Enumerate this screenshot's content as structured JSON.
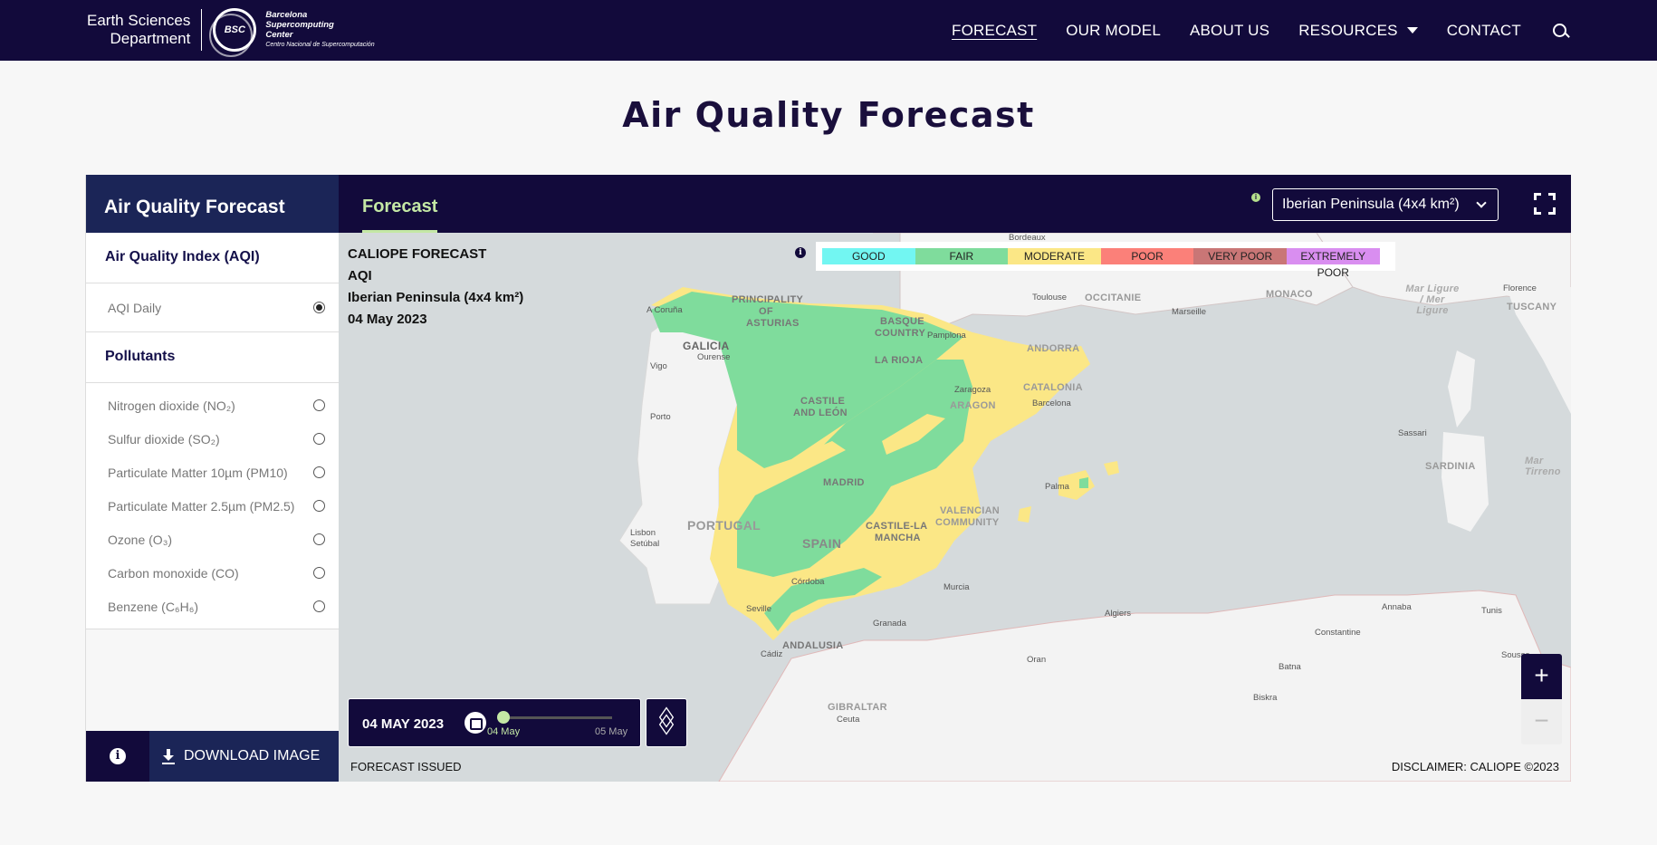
{
  "header": {
    "dept_line1": "Earth Sciences",
    "dept_line2": "Department",
    "bsc_badge": "BSC",
    "bsc_name1": "Barcelona",
    "bsc_name2": "Supercomputing",
    "bsc_name3": "Center",
    "bsc_sub": "Centro Nacional de Supercomputación",
    "nav": [
      "FORECAST",
      "OUR MODEL",
      "ABOUT US",
      "RESOURCES",
      "CONTACT"
    ]
  },
  "page_title": "Air Quality Forecast",
  "sidebar": {
    "title": "Air Quality Forecast",
    "section_aqi": "Air Quality Index (AQI)",
    "aqi_options": [
      {
        "label": "AQI Daily",
        "selected": true
      }
    ],
    "section_pollutants": "Pollutants",
    "pollutants": [
      {
        "label": "Nitrogen dioxide (NO₂)",
        "selected": false
      },
      {
        "label": "Sulfur dioxide (SO₂)",
        "selected": false
      },
      {
        "label": "Particulate Matter 10µm (PM10)",
        "selected": false
      },
      {
        "label": "Particulate Matter 2.5µm (PM2.5)",
        "selected": false
      },
      {
        "label": "Ozone (O₃)",
        "selected": false
      },
      {
        "label": "Carbon monoxide (CO)",
        "selected": false
      },
      {
        "label": "Benzene (C₆H₆)",
        "selected": false
      }
    ],
    "download_label": "DOWNLOAD IMAGE"
  },
  "main": {
    "tab": "Forecast",
    "domain_select": "Iberian Peninsula (4x4 km²)",
    "meta": {
      "line1": "CALIOPE FORECAST",
      "line2": "AQI",
      "line3": "Iberian Peninsula (4x4 km²)",
      "line4": "04 May 2023"
    },
    "legend": [
      {
        "label": "GOOD",
        "color": "#72f6f2"
      },
      {
        "label": "FAIR",
        "color": "#7fdc9c"
      },
      {
        "label": "MODERATE",
        "color": "#fbe786"
      },
      {
        "label": "POOR",
        "color": "#fb8079"
      },
      {
        "label": "VERY POOR",
        "color": "#c97676"
      },
      {
        "label": "EXTREMELY POOR",
        "color": "#d98ef0"
      }
    ],
    "timebar": {
      "date": "04 MAY 2023",
      "start_label": "04 May",
      "end_label": "05 May",
      "progress": 0
    },
    "forecast_issued": "FORECAST ISSUED",
    "disclaimer": "DISCLAIMER: CALIOPE ©2023",
    "zoom_in": "+",
    "zoom_out": "−",
    "map_labels": {
      "galicia": "GALICIA",
      "asturias1": "PRINCIPALITY",
      "asturias2": "OF",
      "asturias3": "ASTURIAS",
      "basque1": "BASQUE",
      "basque2": "COUNTRY",
      "rioja": "LA RIOJA",
      "castile_leon1": "CASTILE",
      "castile_leon2": "AND LEÓN",
      "andorra": "ANDORRA",
      "catalonia": "CATALONIA",
      "aragon": "ARAGON",
      "madrid": "MADRID",
      "portugal": "PORTUGAL",
      "spain": "SPAIN",
      "clm1": "CASTILE-LA",
      "clm2": "MANCHA",
      "valencia1": "VALENCIAN",
      "valencia2": "COMMUNITY",
      "andalusia": "ANDALUSIA",
      "gibraltar": "GIBRALTAR",
      "occitanie": "OCCITANIE",
      "monaco": "MONACO",
      "tuscany": "TUSCANY",
      "sardinia": "SARDINIA",
      "ligure": "Mar Ligure / Mer Ligure",
      "tirreno": "Mar Tirreno",
      "cities": [
        "Bordeaux",
        "A Coruña",
        "Vigo",
        "Ourense",
        "Porto",
        "Lisbon",
        "Setúbal",
        "Seville",
        "Cádiz",
        "Córdoba",
        "Granada",
        "Murcia",
        "Palma",
        "Barcelona",
        "Zaragoza",
        "Pamplona",
        "Toulouse",
        "Marseille",
        "Florence",
        "Sassari",
        "Algiers",
        "Constantine",
        "Annaba",
        "Tunis",
        "Oran",
        "Batna",
        "Biskra",
        "Sousse",
        "Ceuta"
      ]
    }
  }
}
